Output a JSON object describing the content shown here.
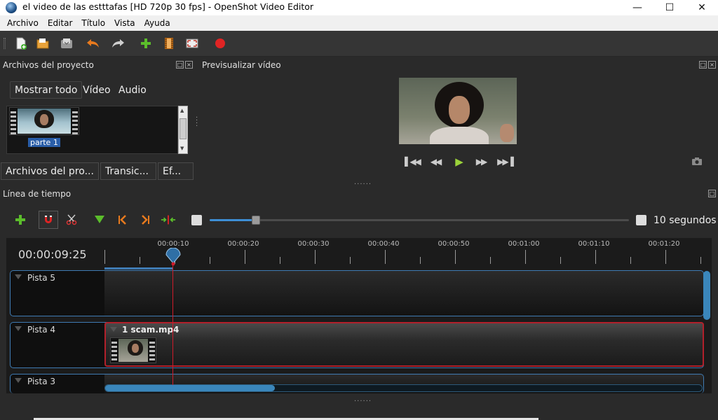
{
  "window": {
    "title": "el  video de las estttafas [HD 720p 30 fps] - OpenShot Video Editor"
  },
  "menu": {
    "items": [
      "Archivo",
      "Editar",
      "Título",
      "Vista",
      "Ayuda"
    ]
  },
  "project_files": {
    "title": "Archivos del proyecto",
    "filters": [
      "Mostrar todo",
      "Vídeo",
      "Audio"
    ],
    "files": [
      {
        "label": "parte 1"
      }
    ],
    "tabs": [
      "Archivos del pro...",
      "Transic...",
      "Ef..."
    ]
  },
  "preview": {
    "title": "Previsualizar vídeo"
  },
  "timeline": {
    "title": "Línea de tiempo",
    "zoom_label": "10 segundos",
    "zoom_fraction": 0.11,
    "current_time": "00:00:09:25",
    "ruler_labels": [
      "00:00:10",
      "00:00:20",
      "00:00:30",
      "00:00:40",
      "00:00:50",
      "00:01:00",
      "00:01:10",
      "00:01:20"
    ],
    "tracks": [
      {
        "name": "Pista 5"
      },
      {
        "name": "Pista 4",
        "clip": "1 scam.mp4"
      },
      {
        "name": "Pista 3"
      }
    ]
  },
  "colors": {
    "accent": "#3a86bb",
    "clip_border": "#b2202b",
    "playhead": "#d01b2a"
  }
}
